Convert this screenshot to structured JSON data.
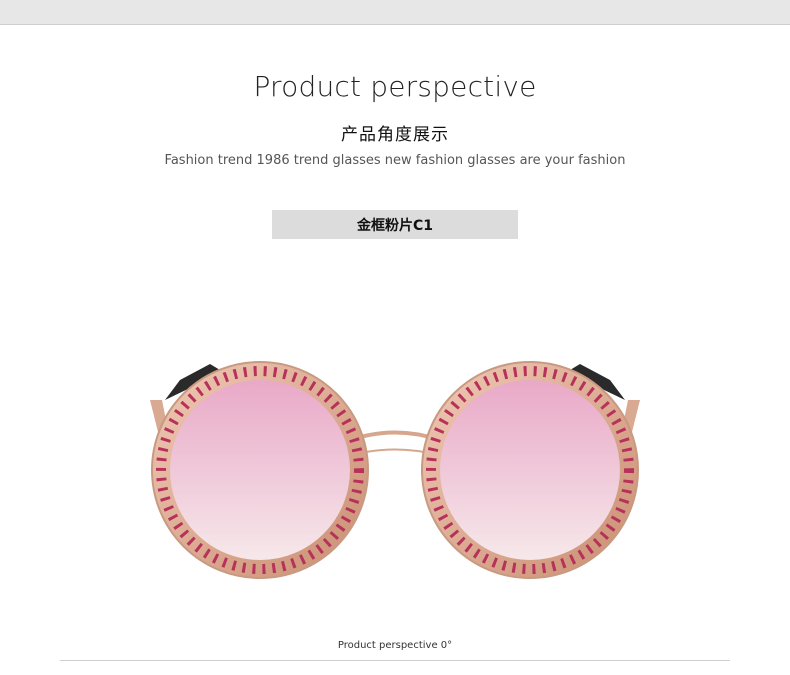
{
  "header": {
    "title": "Product perspective",
    "subtitle_cn": "产品角度展示",
    "tagline": "Fashion trend 1986 trend glasses new fashion glasses are your fashion"
  },
  "variant": {
    "label": "金框粉片C1"
  },
  "product": {
    "frame_color": "#d7a78d",
    "lens_color": "#f1c8d9",
    "gem_color": "#c0325f",
    "icon": "round-jeweled-sunglasses"
  },
  "footer": {
    "caption": "Product perspective 0°"
  }
}
